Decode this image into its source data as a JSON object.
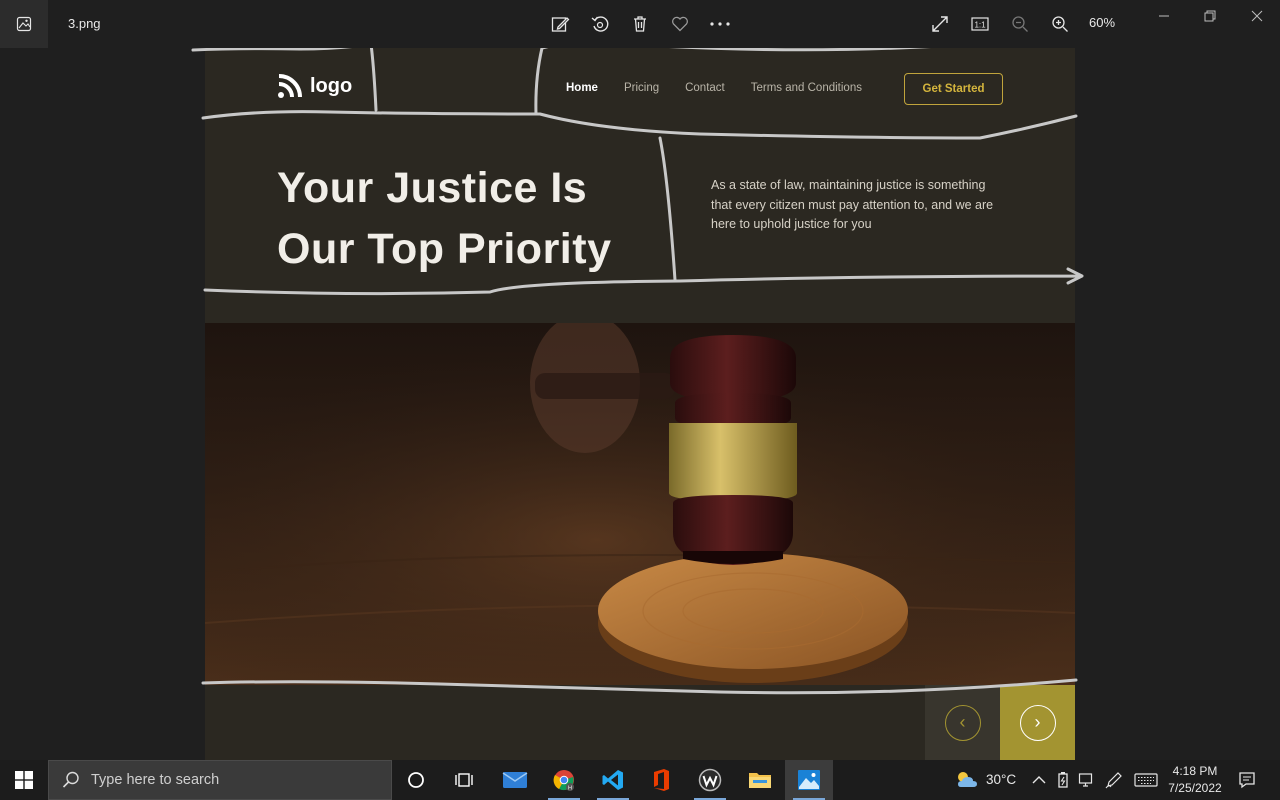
{
  "viewer": {
    "filename": "3.png",
    "zoom": "60%",
    "toolbar_icons": [
      "edit-icon",
      "rotate-icon",
      "delete-icon",
      "favorite-icon",
      "more-icon"
    ],
    "right_icons": [
      "fullscreen-icon",
      "actual-size-icon",
      "zoom-out-icon",
      "zoom-in-icon"
    ],
    "actual_size_label": "1:1"
  },
  "design": {
    "logo_text": "logo",
    "nav": [
      "Home",
      "Pricing",
      "Contact",
      "Terms and Conditions"
    ],
    "cta_label": "Get Started",
    "headline_line1": "Your Justice Is",
    "headline_line2": "Our Top Priority",
    "description": "As a state of law, maintaining justice is something that every citizen must pay attention to, and we are here to uphold justice for you",
    "prev_symbol": "‹",
    "next_symbol": "›",
    "colors": {
      "background": "#2b2821",
      "accent": "#a39431",
      "accent_text": "#d4b53d",
      "text": "#f1eee8"
    }
  },
  "taskbar": {
    "search_placeholder": "Type here to search",
    "apps": [
      "cortana-icon",
      "task-view-icon",
      "mail-icon",
      "chrome-icon",
      "vscode-icon",
      "office-icon",
      "w-app-icon",
      "file-explorer-icon",
      "photos-icon"
    ],
    "weather_temp": "30°C",
    "time": "4:18 PM",
    "date": "7/25/2022"
  }
}
